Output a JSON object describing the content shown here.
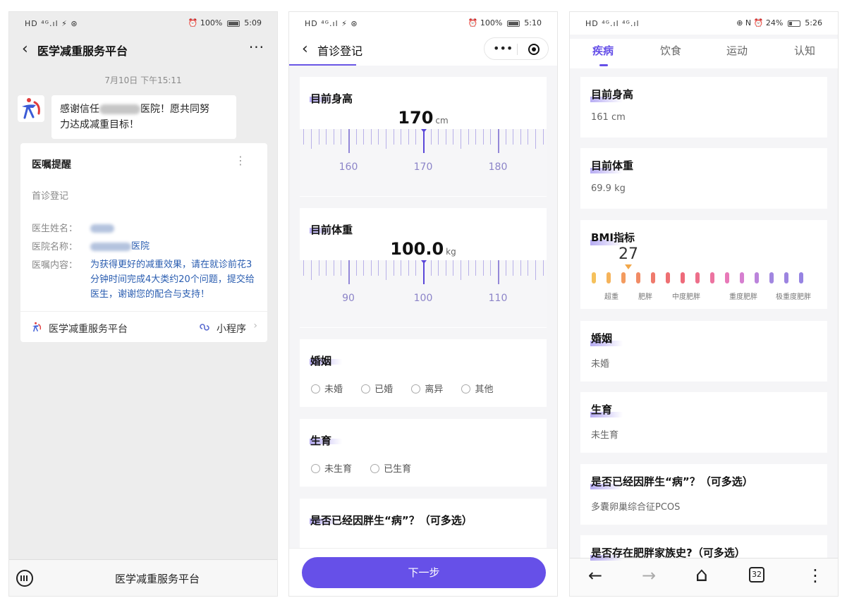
{
  "phone1": {
    "status": {
      "left": "HD ⁴ᴳ.ıl ⚡ ⊛",
      "alarm": "⏰",
      "battery": "100%",
      "time": "5:09"
    },
    "nav": {
      "back": "‹",
      "title": "医学减重服务平台",
      "more": "···"
    },
    "chat_time": "7月10日 下午15:11",
    "message": {
      "line1_prefix": "感谢信任",
      "line1_suffix": "医院！愿共同努",
      "line2": "力达成减重目标！"
    },
    "card": {
      "title": "医嘱提醒",
      "more": "⋮",
      "subtitle": "首诊登记",
      "doctor_label": "医生姓名：",
      "hospital_label": "医院名称：",
      "hospital_suffix": "医院",
      "content_label": "医嘱内容：",
      "content": "为获得更好的减重效果，请在就诊前花3分钟时间完成4大类约20个问题，提交给医生，谢谢您的配合与支持！",
      "footer_name": "医学减重服务平台",
      "footer_mp": "小程序",
      "footer_chevron": "›"
    },
    "bottom": {
      "title": "医学减重服务平台"
    }
  },
  "phone2": {
    "status": {
      "left": "HD ⁴ᴳ.ıl ⚡ ⊛",
      "alarm": "⏰",
      "battery": "100%",
      "time": "5:10"
    },
    "nav": {
      "back": "‹",
      "title": "首诊登记",
      "dots": "•••"
    },
    "height": {
      "title": "目前身高",
      "value": "170",
      "unit": "cm",
      "current": 170,
      "labels": [
        "160",
        "170",
        "180"
      ]
    },
    "weight": {
      "title": "目前体重",
      "value": "100.0",
      "unit": "kg",
      "current": 100,
      "labels": [
        "90",
        "100",
        "110"
      ]
    },
    "marriage": {
      "title": "婚姻",
      "options": [
        "未婚",
        "已婚",
        "离异",
        "其他"
      ]
    },
    "fertility": {
      "title": "生育",
      "options": [
        "未生育",
        "已生育"
      ]
    },
    "disease": {
      "title": "是否已经因胖生“病”？（可多选）"
    },
    "next_button": "下一步"
  },
  "phone3": {
    "status": {
      "left": "HD ⁴ᴳ.ıl ⁴ᴳ.ıl",
      "right": "⊕ N ⏰ 24%",
      "time": "5:26"
    },
    "tabs": [
      "疾病",
      "饮食",
      "运动",
      "认知"
    ],
    "active_tab": "疾病",
    "height": {
      "title": "目前身高",
      "value": "161 cm"
    },
    "weight": {
      "title": "目前体重",
      "value": "69.9 kg"
    },
    "bmi": {
      "title": "BMI指标",
      "value": "27",
      "labels": [
        "超重",
        "肥胖",
        "中度肥胖",
        "重度肥胖",
        "极重度肥胖"
      ],
      "colors": [
        "#f5c15c",
        "#f5b35a",
        "#f39b5f",
        "#f18b65",
        "#ef7a6c",
        "#ee6f72",
        "#ee6a7a",
        "#ed6f8a",
        "#ec73a0",
        "#e879b8",
        "#d67fd0",
        "#bb84db",
        "#a186e0",
        "#9c84e0",
        "#9683e2"
      ]
    },
    "marriage": {
      "title": "婚姻",
      "value": "未婚"
    },
    "fertility": {
      "title": "生育",
      "value": "未生育"
    },
    "disease": {
      "title": "是否已经因胖生“病”？（可多选）",
      "value": "多囊卵巢综合征PCOS"
    },
    "family": {
      "title": "是否存在肥胖家族史?（可多选）"
    },
    "bottom": {
      "back": "←",
      "forward": "→",
      "home": "⌂",
      "tabs": "32",
      "menu": "⋮"
    }
  }
}
